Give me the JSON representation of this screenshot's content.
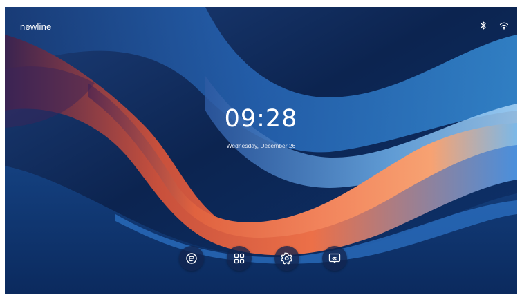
{
  "brand": {
    "logo_text": "newline"
  },
  "status_bar": {
    "icons": [
      "bluetooth-icon",
      "wifi-icon"
    ]
  },
  "clock": {
    "time": "09:28",
    "date": "Wednesday, December 26"
  },
  "dock": {
    "buttons": [
      {
        "icon": "whiteboard-icon"
      },
      {
        "icon": "apps-grid-icon"
      },
      {
        "icon": "settings-gear-icon"
      },
      {
        "icon": "screen-cast-icon"
      }
    ]
  },
  "colors": {
    "background_dark": "#0d2a56",
    "wave_orange": "#f07a52",
    "wave_blue": "#2f7fd1",
    "text": "#ffffff"
  }
}
